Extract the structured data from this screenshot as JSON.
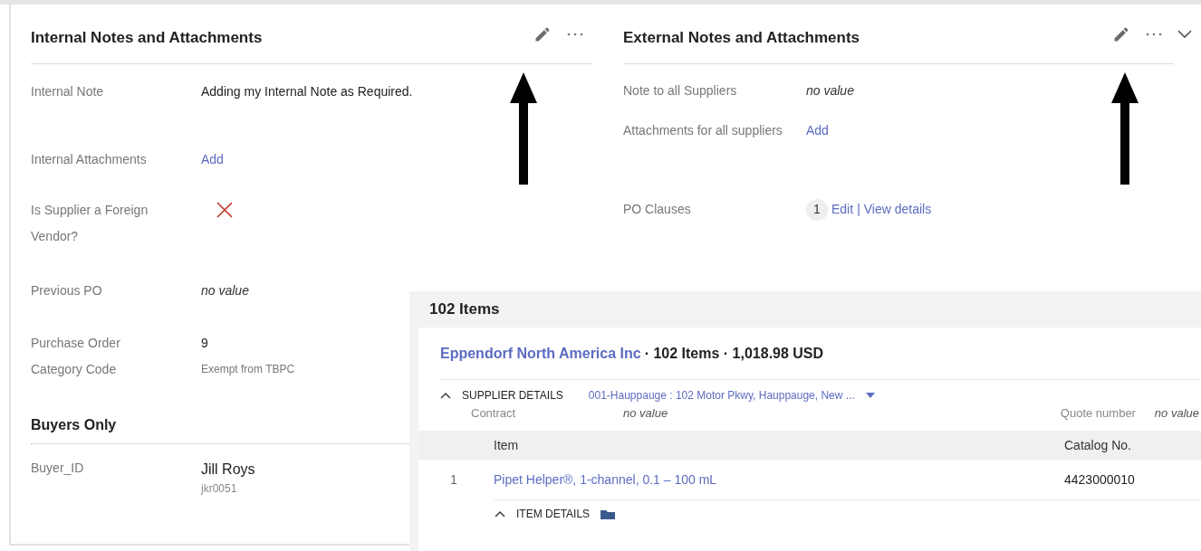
{
  "internal": {
    "title": "Internal Notes and Attachments",
    "fields": [
      {
        "kind": "text",
        "label": "Internal Note",
        "value": "Adding my Internal Note as Required."
      },
      {
        "kind": "link",
        "label": "Internal Attachments",
        "value": "Add"
      },
      {
        "kind": "flag",
        "label": "Is Supplier a Foreign Vendor?",
        "checked": false
      },
      {
        "kind": "empty",
        "label": "Previous PO",
        "value": "no value"
      },
      {
        "kind": "sub",
        "label": "Purchase Order Category Code",
        "value": "9",
        "sub": "Exempt from TBPC"
      }
    ],
    "section": "Buyers Only",
    "buyer": {
      "label": "Buyer_ID",
      "value": "Jill Roys",
      "sub": "jkr0051"
    }
  },
  "external": {
    "title": "External Notes and Attachments",
    "fields": [
      {
        "kind": "empty",
        "label": "Note to all Suppliers",
        "value": "no value"
      },
      {
        "kind": "link",
        "label": "Attachments for all suppliers",
        "value": "Add"
      },
      {
        "kind": "clauses",
        "label": "PO Clauses",
        "count": "1",
        "edit": "Edit",
        "separator": "|",
        "view": "View details"
      }
    ]
  },
  "items": {
    "title": "102 Items",
    "supplier": "Eppendorf North America Inc",
    "summary": "· 102 Items · 1,018.98 USD",
    "details_label": "SUPPLIER DETAILS",
    "address": "001-Hauppauge : 102 Motor Pkwy, Hauppauge, New ...",
    "contract_label": "Contract",
    "contract_value": "no value",
    "quote_label": "Quote number",
    "quote_value": "no value",
    "columns": [
      "Item",
      "Catalog No."
    ],
    "rows": [
      {
        "index": "1",
        "item": "Pipet Helper®, 1-channel, 0.1 – 100 mL",
        "catalog": "4423000010"
      }
    ],
    "item_details_label": "ITEM DETAILS"
  }
}
